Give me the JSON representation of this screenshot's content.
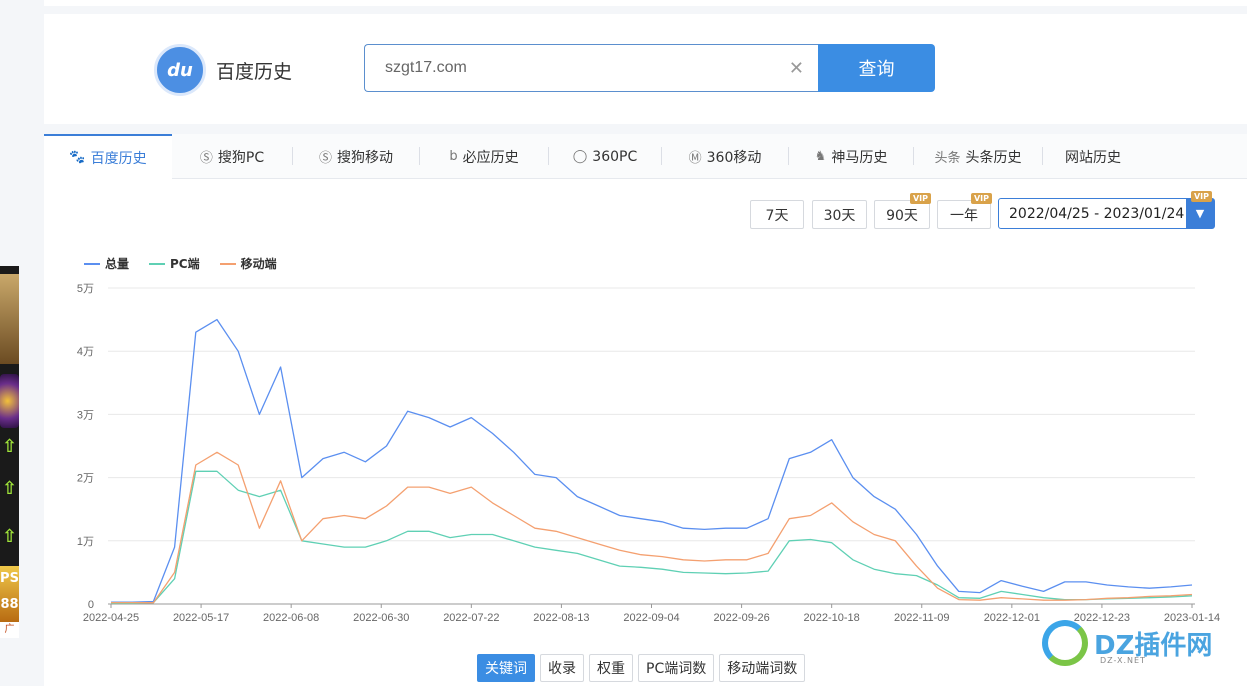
{
  "search": {
    "brand_title": "百度历史",
    "brand_logo_text": "du",
    "query_value": "szgt17.com",
    "clear_icon": "✕",
    "submit_label": "查询"
  },
  "tabs": [
    {
      "icon": "paw-icon",
      "glyph": "🐾",
      "label": "百度历史",
      "active": true
    },
    {
      "icon": "sogou-icon",
      "glyph": "Ⓢ",
      "label": "搜狗PC"
    },
    {
      "icon": "sogou-icon",
      "glyph": "Ⓢ",
      "label": "搜狗移动"
    },
    {
      "icon": "bing-icon",
      "glyph": "b",
      "label": "必应历史"
    },
    {
      "icon": "so360-icon",
      "glyph": "◯",
      "label": "360PC"
    },
    {
      "icon": "so360m-icon",
      "glyph": "Ⓜ",
      "label": "360移动"
    },
    {
      "icon": "shenma-icon",
      "glyph": "♞",
      "label": "神马历史"
    },
    {
      "icon": "toutiao-icon",
      "glyph": "头条",
      "label": "头条历史"
    },
    {
      "icon": "",
      "glyph": "",
      "label": "网站历史"
    }
  ],
  "ranges": {
    "d7": "7天",
    "d30": "30天",
    "d90": "90天",
    "year": "一年",
    "vip": "VIP",
    "date_range": "2022/04/25 - 2023/01/24"
  },
  "colors": {
    "total": "#5b8ff0",
    "pc": "#5fd0b4",
    "mobile": "#f4a070",
    "accent": "#3b8de3"
  },
  "chart_data": {
    "type": "line",
    "series": [
      {
        "name": "总量",
        "color": "#5b8ff0",
        "values": [
          300,
          300,
          400,
          9000,
          43000,
          45000,
          40000,
          30000,
          37500,
          20000,
          23000,
          24000,
          22500,
          25000,
          30500,
          29500,
          28000,
          29500,
          27000,
          24000,
          20500,
          20000,
          17000,
          15500,
          14000,
          13500,
          13000,
          12000,
          11800,
          12000,
          12000,
          13500,
          23000,
          24000,
          26000,
          20000,
          17000,
          15000,
          11000,
          6000,
          2000,
          1800,
          3700,
          2800,
          2000,
          3500,
          3500,
          3000,
          2700,
          2500,
          2700,
          3000
        ]
      },
      {
        "name": "PC端",
        "color": "#5fd0b4",
        "values": [
          100,
          100,
          200,
          4000,
          21000,
          21000,
          18000,
          17000,
          18000,
          10000,
          9500,
          9000,
          9000,
          10000,
          11500,
          11500,
          10500,
          11000,
          11000,
          10000,
          9000,
          8500,
          8000,
          7000,
          6000,
          5800,
          5500,
          5000,
          4900,
          4800,
          4900,
          5200,
          10000,
          10200,
          9700,
          7000,
          5500,
          4800,
          4500,
          3000,
          1000,
          900,
          2000,
          1500,
          1000,
          700,
          700,
          800,
          900,
          1000,
          1100,
          1300
        ]
      },
      {
        "name": "移动端",
        "color": "#f4a070",
        "values": [
          200,
          200,
          200,
          5000,
          22000,
          24000,
          22000,
          12000,
          19500,
          10000,
          13500,
          14000,
          13500,
          15500,
          18500,
          18500,
          17500,
          18500,
          16000,
          14000,
          12000,
          11500,
          10500,
          9500,
          8500,
          7800,
          7500,
          7000,
          6800,
          7000,
          7000,
          8000,
          13500,
          14000,
          16000,
          13000,
          11000,
          10000,
          6000,
          2500,
          700,
          600,
          1000,
          800,
          600,
          600,
          700,
          900,
          1000,
          1200,
          1300,
          1500
        ]
      }
    ],
    "x_tick_labels": [
      "2022-04-25",
      "2022-05-17",
      "2022-06-08",
      "2022-06-30",
      "2022-07-22",
      "2022-08-13",
      "2022-09-04",
      "2022-09-26",
      "2022-10-18",
      "2022-11-09",
      "2022-12-01",
      "2022-12-23",
      "2023-01-14"
    ],
    "y_tick_labels": [
      "0",
      "1万",
      "2万",
      "3万",
      "4万",
      "5万"
    ],
    "ylim": [
      0,
      50000
    ],
    "grid": true,
    "legend_position": "top-left"
  },
  "bottom_tabs": [
    {
      "label": "关键词",
      "active": true
    },
    {
      "label": "收录"
    },
    {
      "label": "权重"
    },
    {
      "label": "PC端词数"
    },
    {
      "label": "移动端词数"
    }
  ],
  "left_ad": {
    "arrow_glyph": "⇧",
    "badge_text": "PS",
    "badge_number": "88",
    "ad_label": "广告"
  },
  "watermark": {
    "text": "DZ插件网",
    "sub": "DZ-X.NET"
  }
}
